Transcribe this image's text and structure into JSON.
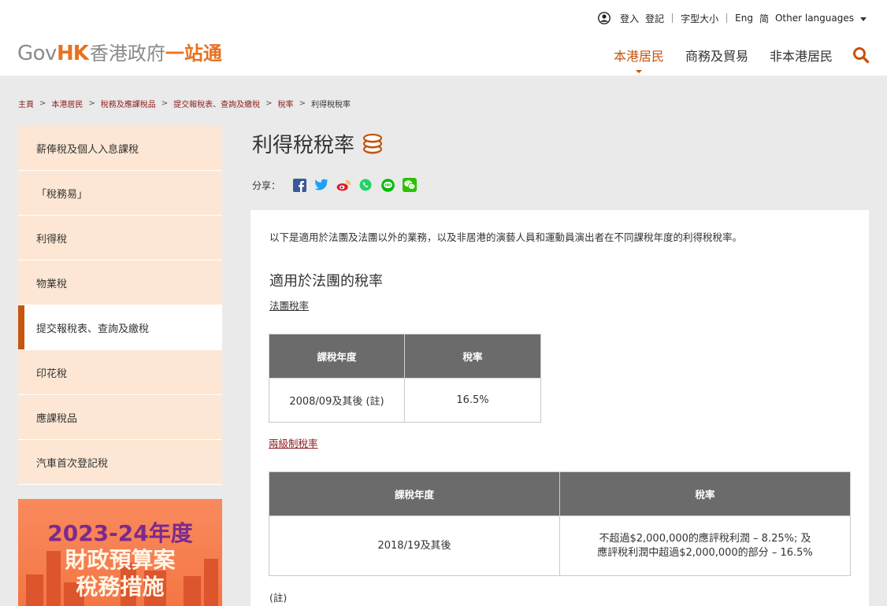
{
  "header": {
    "logo": {
      "gov": "Gov",
      "hk": "HK",
      "zh_grey": "香港政府",
      "zh_orange": "一站通"
    },
    "util": {
      "login": "登入",
      "register": "登記",
      "font_size": "字型大小",
      "eng": "Eng",
      "simplified": "简",
      "other_languages": "Other languages"
    },
    "nav": [
      {
        "label": "本港居民",
        "active": true
      },
      {
        "label": "商務及貿易",
        "active": false
      },
      {
        "label": "非本港居民",
        "active": false
      }
    ]
  },
  "breadcrumb": [
    "主頁",
    "本港居民",
    "稅務及應課稅品",
    "提交報稅表、查詢及繳稅",
    "稅率",
    "利得稅稅率"
  ],
  "sidebar": {
    "items": [
      {
        "label": "薪俸稅及個人入息課稅"
      },
      {
        "label": "「稅務易」"
      },
      {
        "label": "利得稅"
      },
      {
        "label": "物業稅"
      },
      {
        "label": "提交報稅表、查詢及繳稅"
      },
      {
        "label": "印花稅"
      },
      {
        "label": "應課稅品"
      },
      {
        "label": "汽車首次登記稅"
      }
    ],
    "banner": {
      "line1": "2023-24年度",
      "line2": "財政預算案",
      "line3": "稅務措施"
    }
  },
  "main": {
    "title": "利得稅稅率",
    "share_label": "分享：",
    "intro": "以下是適用於法團及法團以外的業務，以及非居港的演藝人員和運動員演出者在不同課稅年度的利得稅稅率。",
    "section_title": "適用於法團的稅率",
    "link1": "法團稅率",
    "table1": {
      "headers": [
        "課稅年度",
        "稅率"
      ],
      "rows": [
        [
          "2008/09及其後 (註)",
          "16.5%"
        ]
      ]
    },
    "link2": "兩級制稅率",
    "table2": {
      "headers": [
        "課稅年度",
        "稅率"
      ],
      "rows": [
        [
          "2018/19及其後",
          "不超過$2,000,000的應評稅利潤 – 8.25%; 及",
          "應評稅利潤中超過$2,000,000的部分 – 16.5%"
        ]
      ]
    },
    "note": "(註)"
  },
  "colors": {
    "accent": "#c5550f",
    "brand_orange": "#e8711f",
    "sidebar_bg": "#fde7d4",
    "table_header": "#6b6b6b",
    "link_red": "#8b1a1a"
  }
}
